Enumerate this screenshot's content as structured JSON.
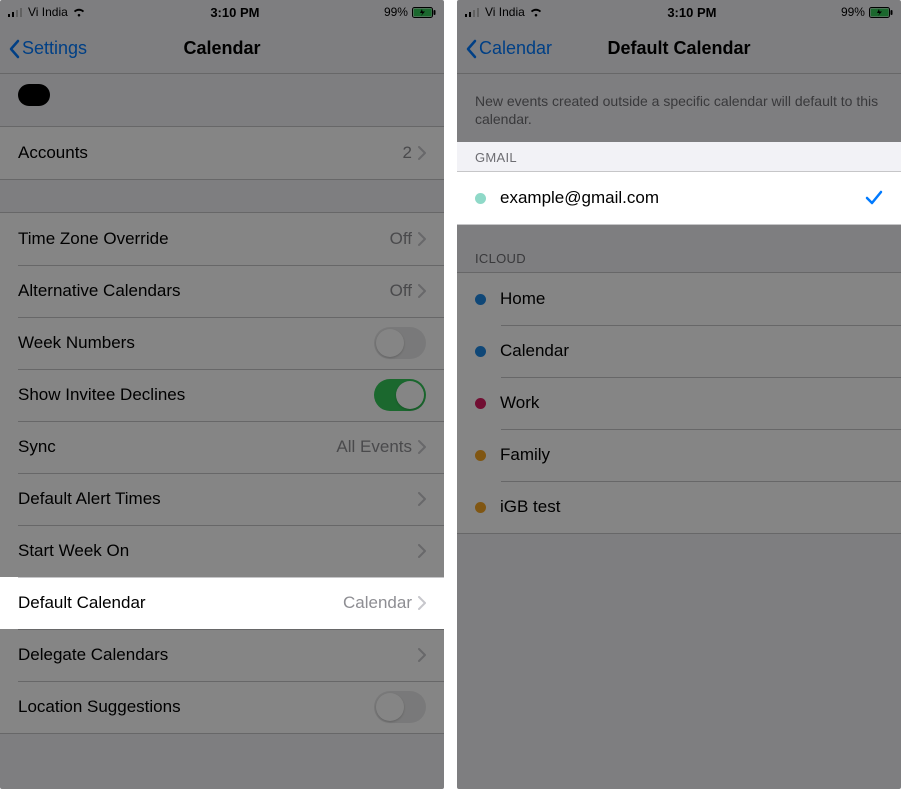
{
  "status": {
    "carrier": "Vi India",
    "time": "3:10 PM",
    "battery": "99%"
  },
  "left": {
    "back_label": "Settings",
    "title": "Calendar",
    "accounts_label": "Accounts",
    "accounts_value": "2",
    "rows": {
      "tz_label": "Time Zone Override",
      "tz_value": "Off",
      "alt_label": "Alternative Calendars",
      "alt_value": "Off",
      "week_label": "Week Numbers",
      "invitee_label": "Show Invitee Declines",
      "sync_label": "Sync",
      "sync_value": "All Events",
      "alert_label": "Default Alert Times",
      "week_start_label": "Start Week On",
      "default_cal_label": "Default Calendar",
      "default_cal_value": "Calendar",
      "delegate_label": "Delegate Calendars",
      "location_label": "Location Suggestions"
    }
  },
  "right": {
    "back_label": "Calendar",
    "title": "Default Calendar",
    "info": "New events created outside a specific calendar will default to this calendar.",
    "groups": {
      "gmail_header": "GMAIL",
      "gmail_item": "example@gmail.com",
      "icloud_header": "ICLOUD",
      "icloud_items": [
        {
          "label": "Home",
          "color": "#1e88e5"
        },
        {
          "label": "Calendar",
          "color": "#1e88e5"
        },
        {
          "label": "Work",
          "color": "#d81b60"
        },
        {
          "label": "Family",
          "color": "#f5a623"
        },
        {
          "label": "iGB test",
          "color": "#f5a623"
        }
      ],
      "gmail_color": "#8fd9c8"
    }
  }
}
